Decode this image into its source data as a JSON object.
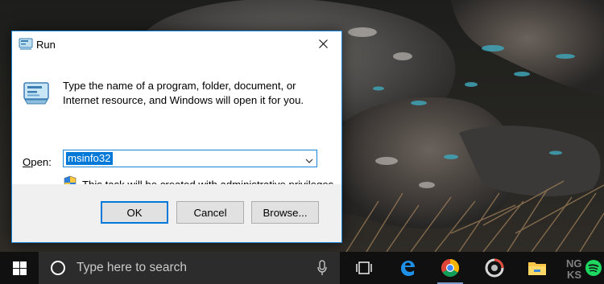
{
  "run_dialog": {
    "title": "Run",
    "description": "Type the name of a program, folder, document, or Internet resource, and Windows will open it for you.",
    "open_label_accesskey": "O",
    "open_label_rest": "pen:",
    "open_value": "msinfo32",
    "admin_notice": "This task will be created with administrative privileges.",
    "buttons": {
      "ok": "OK",
      "cancel": "Cancel",
      "browse": "Browse..."
    }
  },
  "taskbar": {
    "search_placeholder": "Type here to search",
    "pinned_icons": [
      "task-view-icon",
      "edge-icon",
      "chrome-icon",
      "photoscape-icon",
      "file-explorer-icon",
      "spotify-icon"
    ]
  },
  "watermark": "NG KS",
  "colors": {
    "accent": "#0078d7",
    "dialog_border": "#1883d7",
    "taskbar": "#101010",
    "search_box": "#2c2c2c"
  }
}
